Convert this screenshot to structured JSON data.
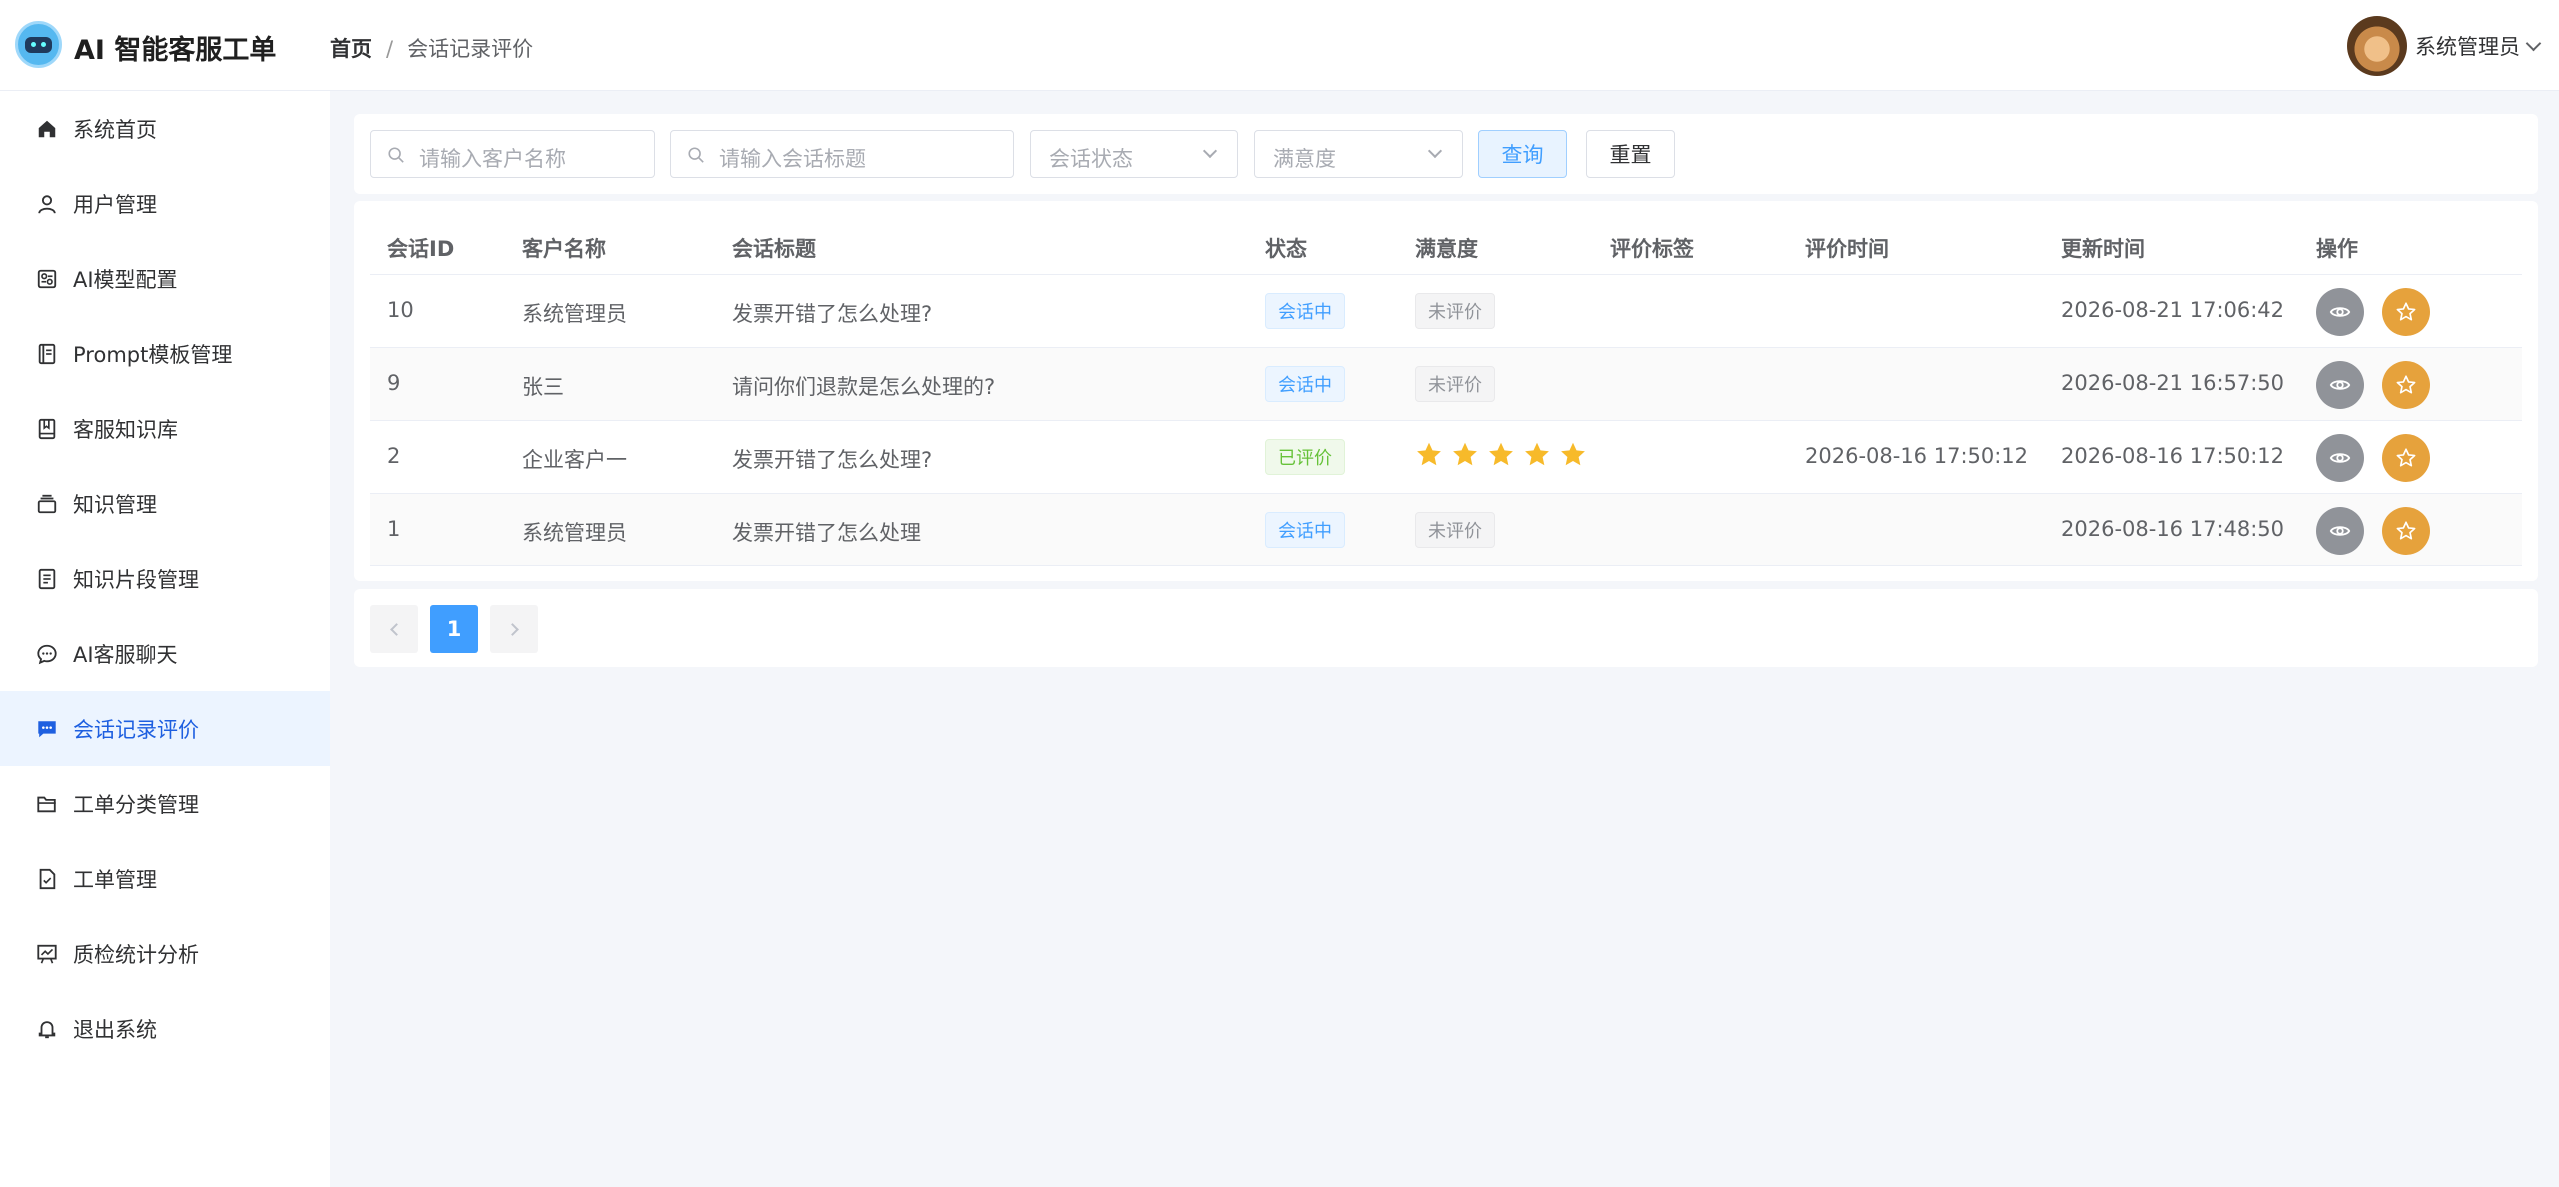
{
  "app": {
    "title": "AI 智能客服工单"
  },
  "breadcrumb": {
    "home": "首页",
    "current": "会话记录评价"
  },
  "user": {
    "name": "系统管理员"
  },
  "sidebar": {
    "items": [
      {
        "label": "系统首页",
        "icon": "home-icon"
      },
      {
        "label": "用户管理",
        "icon": "user-icon"
      },
      {
        "label": "AI模型配置",
        "icon": "model-config-icon"
      },
      {
        "label": "Prompt模板管理",
        "icon": "template-icon"
      },
      {
        "label": "客服知识库",
        "icon": "book-icon"
      },
      {
        "label": "知识管理",
        "icon": "stack-icon"
      },
      {
        "label": "知识片段管理",
        "icon": "document-icon"
      },
      {
        "label": "AI客服聊天",
        "icon": "chat-icon"
      },
      {
        "label": "会话记录评价",
        "icon": "chat-dots-icon",
        "active": true
      },
      {
        "label": "工单分类管理",
        "icon": "folder-icon"
      },
      {
        "label": "工单管理",
        "icon": "file-check-icon"
      },
      {
        "label": "质检统计分析",
        "icon": "chart-board-icon"
      },
      {
        "label": "退出系统",
        "icon": "bell-icon"
      }
    ]
  },
  "search": {
    "customer_placeholder": "请输入客户名称",
    "title_placeholder": "请输入会话标题",
    "status_placeholder": "会话状态",
    "satisfaction_placeholder": "满意度",
    "query_label": "查询",
    "reset_label": "重置"
  },
  "table": {
    "headers": {
      "id": "会话ID",
      "customer": "客户名称",
      "title": "会话标题",
      "status": "状态",
      "satisfaction": "满意度",
      "tags": "评价标签",
      "rated_time": "评价时间",
      "updated_time": "更新时间",
      "actions": "操作"
    },
    "rows": [
      {
        "id": "10",
        "customer": "系统管理员",
        "title": "发票开错了怎么处理?",
        "status": "会话中",
        "satisfaction": "未评价",
        "stars": 0,
        "rated_time": "",
        "updated_time": "2026-08-21 17:06:42"
      },
      {
        "id": "9",
        "customer": "张三",
        "title": "请问你们退款是怎么处理的?",
        "status": "会话中",
        "satisfaction": "未评价",
        "stars": 0,
        "rated_time": "",
        "updated_time": "2026-08-21 16:57:50"
      },
      {
        "id": "2",
        "customer": "企业客户一",
        "title": "发票开错了怎么处理?",
        "status": "已评价",
        "satisfaction": "",
        "stars": 5,
        "rated_time": "2026-08-16 17:50:12",
        "updated_time": "2026-08-16 17:50:12"
      },
      {
        "id": "1",
        "customer": "系统管理员",
        "title": "发票开错了怎么处理",
        "status": "会话中",
        "satisfaction": "未评价",
        "stars": 0,
        "rated_time": "",
        "updated_time": "2026-08-16 17:48:50"
      }
    ]
  },
  "pagination": {
    "current": "1"
  },
  "colors": {
    "primary": "#409eff",
    "active_nav": "#1e5fe0",
    "rate_button": "#e6a23c",
    "view_button": "#909399",
    "star": "#f7ba2a"
  }
}
